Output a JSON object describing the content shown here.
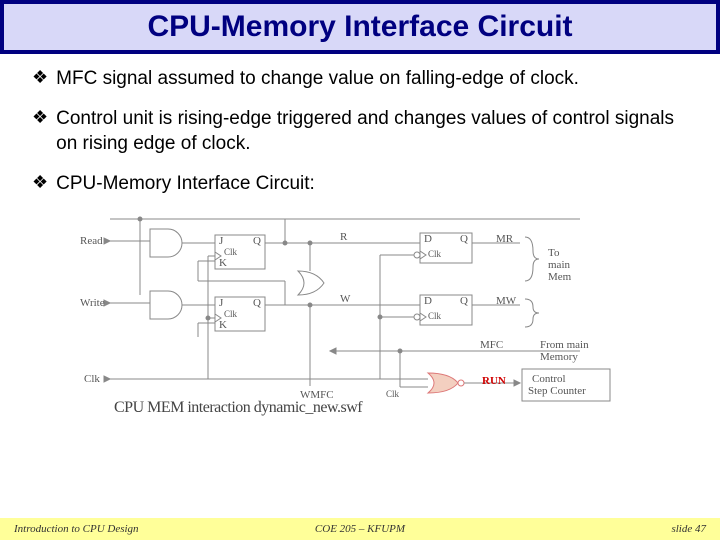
{
  "title": "CPU-Memory Interface Circuit",
  "bullets": [
    "MFC signal assumed to change value on falling-edge of clock.",
    "Control unit is rising-edge triggered and changes values of control signals on rising edge of clock.",
    "CPU-Memory Interface Circuit:"
  ],
  "diagram": {
    "inputs": {
      "read": "Read",
      "write": "Write",
      "clk": "Clk"
    },
    "jk": {
      "j": "J",
      "k": "K",
      "clk": "Clk",
      "q": "Q"
    },
    "dff": {
      "d": "D",
      "q": "Q",
      "clk": "Clk"
    },
    "wires": {
      "r": "R",
      "w": "W",
      "wmfc": "WMFC",
      "mfc": "MFC"
    },
    "outputs": {
      "mr": "MR",
      "mw": "MW",
      "to_mem": [
        "To",
        "main",
        "Mem"
      ],
      "from_mem": [
        "From main",
        "Memory"
      ]
    },
    "control_box": [
      "Control",
      "Step Counter"
    ],
    "run": "RUN",
    "swf": "CPU MEM interaction dynamic_new.swf"
  },
  "footer": {
    "left": "Introduction to CPU Design",
    "mid": "COE 205 – KFUPM",
    "right": "slide 47"
  }
}
